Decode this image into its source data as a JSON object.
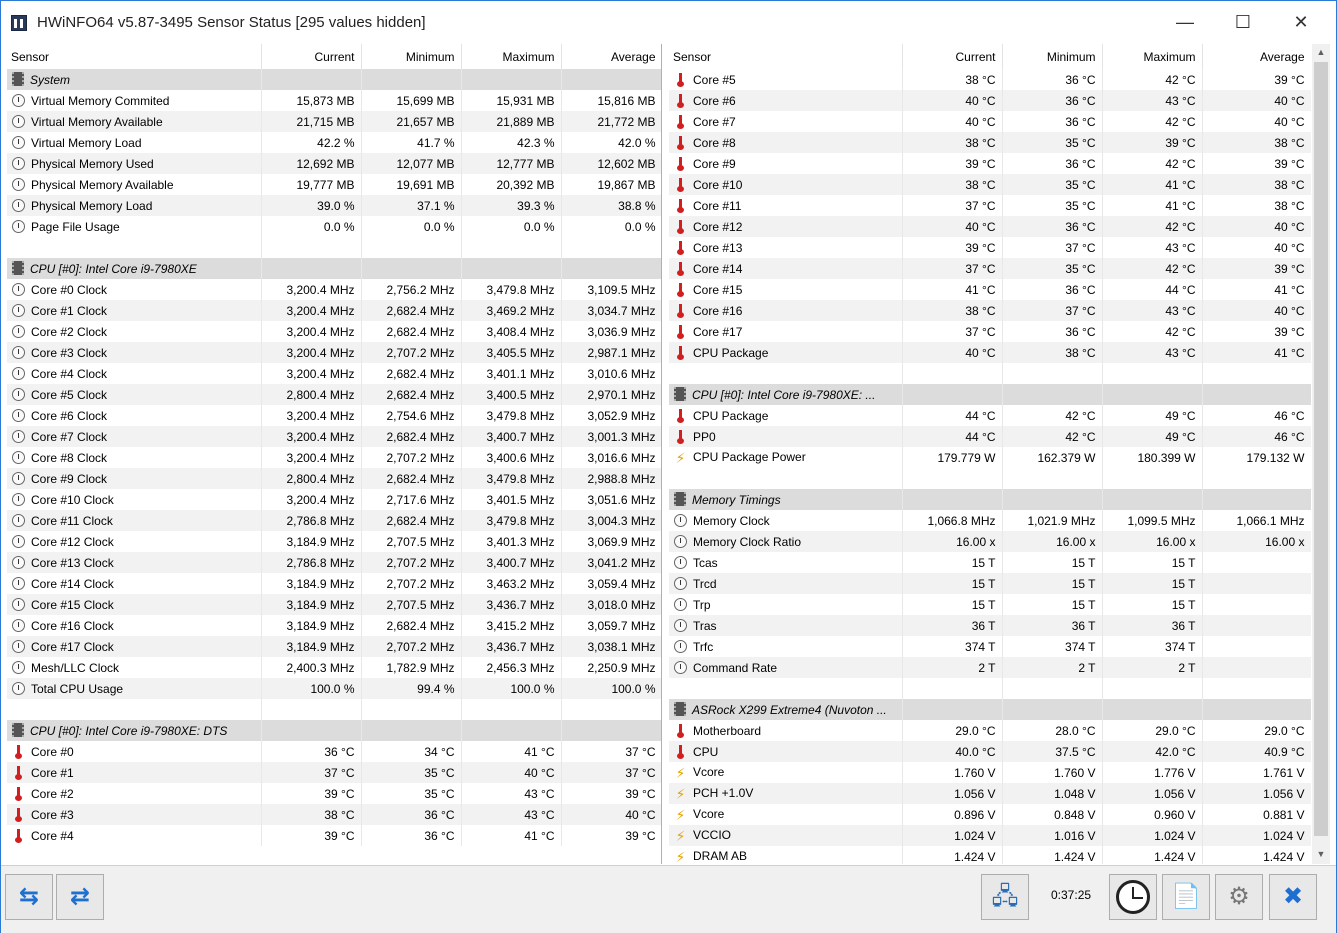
{
  "window": {
    "title": "HWiNFO64 v5.87-3495 Sensor Status [295 values hidden]",
    "minimize_glyph": "—",
    "maximize_glyph": "☐",
    "close_glyph": "✕"
  },
  "columns": [
    "Sensor",
    "Current",
    "Minimum",
    "Maximum",
    "Average"
  ],
  "left_rows": [
    {
      "t": "group",
      "n": "System"
    },
    {
      "t": "row",
      "i": "clock",
      "n": "Virtual Memory Commited",
      "v": [
        "15,873 MB",
        "15,699 MB",
        "15,931 MB",
        "15,816 MB"
      ]
    },
    {
      "t": "row",
      "i": "clock",
      "n": "Virtual Memory Available",
      "v": [
        "21,715 MB",
        "21,657 MB",
        "21,889 MB",
        "21,772 MB"
      ]
    },
    {
      "t": "row",
      "i": "clock",
      "n": "Virtual Memory Load",
      "v": [
        "42.2 %",
        "41.7 %",
        "42.3 %",
        "42.0 %"
      ]
    },
    {
      "t": "row",
      "i": "clock",
      "n": "Physical Memory Used",
      "v": [
        "12,692 MB",
        "12,077 MB",
        "12,777 MB",
        "12,602 MB"
      ]
    },
    {
      "t": "row",
      "i": "clock",
      "n": "Physical Memory Available",
      "v": [
        "19,777 MB",
        "19,691 MB",
        "20,392 MB",
        "19,867 MB"
      ]
    },
    {
      "t": "row",
      "i": "clock",
      "n": "Physical Memory Load",
      "v": [
        "39.0 %",
        "37.1 %",
        "39.3 %",
        "38.8 %"
      ]
    },
    {
      "t": "row",
      "i": "clock",
      "n": "Page File Usage",
      "v": [
        "0.0 %",
        "0.0 %",
        "0.0 %",
        "0.0 %"
      ]
    },
    {
      "t": "blank"
    },
    {
      "t": "group",
      "n": "CPU [#0]: Intel Core i9-7980XE"
    },
    {
      "t": "row",
      "i": "clock",
      "n": "Core #0 Clock",
      "v": [
        "3,200.4 MHz",
        "2,756.2 MHz",
        "3,479.8 MHz",
        "3,109.5 MHz"
      ]
    },
    {
      "t": "row",
      "i": "clock",
      "n": "Core #1 Clock",
      "v": [
        "3,200.4 MHz",
        "2,682.4 MHz",
        "3,469.2 MHz",
        "3,034.7 MHz"
      ]
    },
    {
      "t": "row",
      "i": "clock",
      "n": "Core #2 Clock",
      "v": [
        "3,200.4 MHz",
        "2,682.4 MHz",
        "3,408.4 MHz",
        "3,036.9 MHz"
      ]
    },
    {
      "t": "row",
      "i": "clock",
      "n": "Core #3 Clock",
      "v": [
        "3,200.4 MHz",
        "2,707.2 MHz",
        "3,405.5 MHz",
        "2,987.1 MHz"
      ]
    },
    {
      "t": "row",
      "i": "clock",
      "n": "Core #4 Clock",
      "v": [
        "3,200.4 MHz",
        "2,682.4 MHz",
        "3,401.1 MHz",
        "3,010.6 MHz"
      ]
    },
    {
      "t": "row",
      "i": "clock",
      "n": "Core #5 Clock",
      "v": [
        "2,800.4 MHz",
        "2,682.4 MHz",
        "3,400.5 MHz",
        "2,970.1 MHz"
      ]
    },
    {
      "t": "row",
      "i": "clock",
      "n": "Core #6 Clock",
      "v": [
        "3,200.4 MHz",
        "2,754.6 MHz",
        "3,479.8 MHz",
        "3,052.9 MHz"
      ]
    },
    {
      "t": "row",
      "i": "clock",
      "n": "Core #7 Clock",
      "v": [
        "3,200.4 MHz",
        "2,682.4 MHz",
        "3,400.7 MHz",
        "3,001.3 MHz"
      ]
    },
    {
      "t": "row",
      "i": "clock",
      "n": "Core #8 Clock",
      "v": [
        "3,200.4 MHz",
        "2,707.2 MHz",
        "3,400.6 MHz",
        "3,016.6 MHz"
      ]
    },
    {
      "t": "row",
      "i": "clock",
      "n": "Core #9 Clock",
      "v": [
        "2,800.4 MHz",
        "2,682.4 MHz",
        "3,479.8 MHz",
        "2,988.8 MHz"
      ]
    },
    {
      "t": "row",
      "i": "clock",
      "n": "Core #10 Clock",
      "v": [
        "3,200.4 MHz",
        "2,717.6 MHz",
        "3,401.5 MHz",
        "3,051.6 MHz"
      ]
    },
    {
      "t": "row",
      "i": "clock",
      "n": "Core #11 Clock",
      "v": [
        "2,786.8 MHz",
        "2,682.4 MHz",
        "3,479.8 MHz",
        "3,004.3 MHz"
      ]
    },
    {
      "t": "row",
      "i": "clock",
      "n": "Core #12 Clock",
      "v": [
        "3,184.9 MHz",
        "2,707.5 MHz",
        "3,401.3 MHz",
        "3,069.9 MHz"
      ]
    },
    {
      "t": "row",
      "i": "clock",
      "n": "Core #13 Clock",
      "v": [
        "2,786.8 MHz",
        "2,707.2 MHz",
        "3,400.7 MHz",
        "3,041.2 MHz"
      ]
    },
    {
      "t": "row",
      "i": "clock",
      "n": "Core #14 Clock",
      "v": [
        "3,184.9 MHz",
        "2,707.2 MHz",
        "3,463.2 MHz",
        "3,059.4 MHz"
      ]
    },
    {
      "t": "row",
      "i": "clock",
      "n": "Core #15 Clock",
      "v": [
        "3,184.9 MHz",
        "2,707.5 MHz",
        "3,436.7 MHz",
        "3,018.0 MHz"
      ]
    },
    {
      "t": "row",
      "i": "clock",
      "n": "Core #16 Clock",
      "v": [
        "3,184.9 MHz",
        "2,682.4 MHz",
        "3,415.2 MHz",
        "3,059.7 MHz"
      ]
    },
    {
      "t": "row",
      "i": "clock",
      "n": "Core #17 Clock",
      "v": [
        "3,184.9 MHz",
        "2,707.2 MHz",
        "3,436.7 MHz",
        "3,038.1 MHz"
      ]
    },
    {
      "t": "row",
      "i": "clock",
      "n": "Mesh/LLC Clock",
      "v": [
        "2,400.3 MHz",
        "1,782.9 MHz",
        "2,456.3 MHz",
        "2,250.9 MHz"
      ]
    },
    {
      "t": "row",
      "i": "clock",
      "n": "Total CPU Usage",
      "v": [
        "100.0 %",
        "99.4 %",
        "100.0 %",
        "100.0 %"
      ]
    },
    {
      "t": "blank"
    },
    {
      "t": "group",
      "n": "CPU [#0]: Intel Core i9-7980XE: DTS"
    },
    {
      "t": "row",
      "i": "temp",
      "n": "Core #0",
      "v": [
        "36 °C",
        "34 °C",
        "41 °C",
        "37 °C"
      ]
    },
    {
      "t": "row",
      "i": "temp",
      "n": "Core #1",
      "v": [
        "37 °C",
        "35 °C",
        "40 °C",
        "37 °C"
      ]
    },
    {
      "t": "row",
      "i": "temp",
      "n": "Core #2",
      "v": [
        "39 °C",
        "35 °C",
        "43 °C",
        "39 °C"
      ]
    },
    {
      "t": "row",
      "i": "temp",
      "n": "Core #3",
      "v": [
        "38 °C",
        "36 °C",
        "43 °C",
        "40 °C"
      ]
    },
    {
      "t": "row",
      "i": "temp",
      "n": "Core #4",
      "v": [
        "39 °C",
        "36 °C",
        "41 °C",
        "39 °C"
      ]
    }
  ],
  "right_rows": [
    {
      "t": "row",
      "i": "temp",
      "n": "Core #5",
      "v": [
        "38 °C",
        "36 °C",
        "42 °C",
        "39 °C"
      ]
    },
    {
      "t": "row",
      "i": "temp",
      "n": "Core #6",
      "v": [
        "40 °C",
        "36 °C",
        "43 °C",
        "40 °C"
      ]
    },
    {
      "t": "row",
      "i": "temp",
      "n": "Core #7",
      "v": [
        "40 °C",
        "36 °C",
        "42 °C",
        "40 °C"
      ]
    },
    {
      "t": "row",
      "i": "temp",
      "n": "Core #8",
      "v": [
        "38 °C",
        "35 °C",
        "39 °C",
        "38 °C"
      ]
    },
    {
      "t": "row",
      "i": "temp",
      "n": "Core #9",
      "v": [
        "39 °C",
        "36 °C",
        "42 °C",
        "39 °C"
      ]
    },
    {
      "t": "row",
      "i": "temp",
      "n": "Core #10",
      "v": [
        "38 °C",
        "35 °C",
        "41 °C",
        "38 °C"
      ]
    },
    {
      "t": "row",
      "i": "temp",
      "n": "Core #11",
      "v": [
        "37 °C",
        "35 °C",
        "41 °C",
        "38 °C"
      ]
    },
    {
      "t": "row",
      "i": "temp",
      "n": "Core #12",
      "v": [
        "40 °C",
        "36 °C",
        "42 °C",
        "40 °C"
      ]
    },
    {
      "t": "row",
      "i": "temp",
      "n": "Core #13",
      "v": [
        "39 °C",
        "37 °C",
        "43 °C",
        "40 °C"
      ]
    },
    {
      "t": "row",
      "i": "temp",
      "n": "Core #14",
      "v": [
        "37 °C",
        "35 °C",
        "42 °C",
        "39 °C"
      ]
    },
    {
      "t": "row",
      "i": "temp",
      "n": "Core #15",
      "v": [
        "41 °C",
        "36 °C",
        "44 °C",
        "41 °C"
      ]
    },
    {
      "t": "row",
      "i": "temp",
      "n": "Core #16",
      "v": [
        "38 °C",
        "37 °C",
        "43 °C",
        "40 °C"
      ]
    },
    {
      "t": "row",
      "i": "temp",
      "n": "Core #17",
      "v": [
        "37 °C",
        "36 °C",
        "42 °C",
        "39 °C"
      ]
    },
    {
      "t": "row",
      "i": "temp",
      "n": "CPU Package",
      "v": [
        "40 °C",
        "38 °C",
        "43 °C",
        "41 °C"
      ]
    },
    {
      "t": "blank"
    },
    {
      "t": "group",
      "n": "CPU [#0]: Intel Core i9-7980XE: ..."
    },
    {
      "t": "row",
      "i": "temp",
      "n": "CPU Package",
      "v": [
        "44 °C",
        "42 °C",
        "49 °C",
        "46 °C"
      ]
    },
    {
      "t": "row",
      "i": "temp",
      "n": "PP0",
      "v": [
        "44 °C",
        "42 °C",
        "49 °C",
        "46 °C"
      ]
    },
    {
      "t": "row",
      "i": "volt",
      "n": "CPU Package Power",
      "v": [
        "179.779 W",
        "162.379 W",
        "180.399 W",
        "179.132 W"
      ]
    },
    {
      "t": "blank"
    },
    {
      "t": "group",
      "n": "Memory Timings"
    },
    {
      "t": "row",
      "i": "clock",
      "n": "Memory Clock",
      "v": [
        "1,066.8 MHz",
        "1,021.9 MHz",
        "1,099.5 MHz",
        "1,066.1 MHz"
      ]
    },
    {
      "t": "row",
      "i": "clock",
      "n": "Memory Clock Ratio",
      "v": [
        "16.00 x",
        "16.00 x",
        "16.00 x",
        "16.00 x"
      ]
    },
    {
      "t": "row",
      "i": "clock",
      "n": "Tcas",
      "v": [
        "15 T",
        "15 T",
        "15 T",
        ""
      ]
    },
    {
      "t": "row",
      "i": "clock",
      "n": "Trcd",
      "v": [
        "15 T",
        "15 T",
        "15 T",
        ""
      ]
    },
    {
      "t": "row",
      "i": "clock",
      "n": "Trp",
      "v": [
        "15 T",
        "15 T",
        "15 T",
        ""
      ]
    },
    {
      "t": "row",
      "i": "clock",
      "n": "Tras",
      "v": [
        "36 T",
        "36 T",
        "36 T",
        ""
      ]
    },
    {
      "t": "row",
      "i": "clock",
      "n": "Trfc",
      "v": [
        "374 T",
        "374 T",
        "374 T",
        ""
      ]
    },
    {
      "t": "row",
      "i": "clock",
      "n": "Command Rate",
      "v": [
        "2 T",
        "2 T",
        "2 T",
        ""
      ]
    },
    {
      "t": "blank"
    },
    {
      "t": "group",
      "n": "ASRock X299 Extreme4 (Nuvoton ..."
    },
    {
      "t": "row",
      "i": "temp",
      "n": "Motherboard",
      "v": [
        "29.0 °C",
        "28.0 °C",
        "29.0 °C",
        "29.0 °C"
      ]
    },
    {
      "t": "row",
      "i": "temp",
      "n": "CPU",
      "v": [
        "40.0 °C",
        "37.5 °C",
        "42.0 °C",
        "40.9 °C"
      ]
    },
    {
      "t": "row",
      "i": "volt",
      "n": "Vcore",
      "v": [
        "1.760 V",
        "1.760 V",
        "1.776 V",
        "1.761 V"
      ]
    },
    {
      "t": "row",
      "i": "volt",
      "n": "PCH +1.0V",
      "v": [
        "1.056 V",
        "1.048 V",
        "1.056 V",
        "1.056 V"
      ]
    },
    {
      "t": "row",
      "i": "volt",
      "n": "Vcore",
      "v": [
        "0.896 V",
        "0.848 V",
        "0.960 V",
        "0.881 V"
      ]
    },
    {
      "t": "row",
      "i": "volt",
      "n": "VCCIO",
      "v": [
        "1.024 V",
        "1.016 V",
        "1.024 V",
        "1.024 V"
      ]
    },
    {
      "t": "row",
      "i": "volt",
      "n": "DRAM AB",
      "v": [
        "1.424 V",
        "1.424 V",
        "1.424 V",
        "1.424 V"
      ]
    }
  ],
  "toolbar": {
    "expand_glyph": "⇆",
    "collapse_glyph": "⇄",
    "network_glyph": "🖧",
    "timer": "0:37:25",
    "log_glyph": "📄",
    "settings_glyph": "⚙",
    "close_glyph": "✖"
  },
  "scroll": {
    "up": "▲",
    "down": "▼"
  }
}
